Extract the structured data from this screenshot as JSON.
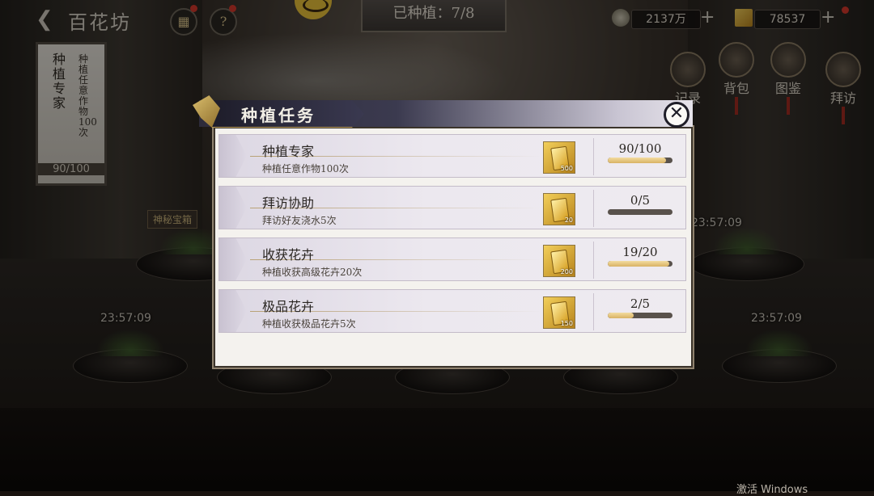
{
  "hud": {
    "title": "百花坊",
    "planted": "已种植：7/8",
    "coins": "2137万",
    "gold": "78537",
    "side_buttons": [
      "记录",
      "背包",
      "图鉴",
      "拜访"
    ]
  },
  "scroll_banner": {
    "title": "种植专家",
    "desc": "种植任意作物100次",
    "progress": "90/100"
  },
  "mystery_box": "神秘宝箱",
  "pot_timers": [
    "23:57:09",
    "23:57:09",
    "23:57:09"
  ],
  "modal": {
    "title": "种植任务",
    "tasks": [
      {
        "name": "种植专家",
        "desc": "种植任意作物100次",
        "reward_qty": "500",
        "progress": "90/100",
        "fraction": 0.9
      },
      {
        "name": "拜访协助",
        "desc": "拜访好友浇水5次",
        "reward_qty": "20",
        "progress": "0/5",
        "fraction": 0.0
      },
      {
        "name": "收获花卉",
        "desc": "种植收获高级花卉20次",
        "reward_qty": "200",
        "progress": "19/20",
        "fraction": 0.95
      },
      {
        "name": "极品花卉",
        "desc": "种植收获极品花卉5次",
        "reward_qty": "150",
        "progress": "2/5",
        "fraction": 0.4
      }
    ]
  },
  "watermark": "激活 Windows",
  "icons": {
    "back": "back-arrow-icon",
    "grid": "grid-menu-icon",
    "help": "help-icon",
    "coin": "coin-icon",
    "gold": "gold-bar-icon",
    "close": "close-icon"
  },
  "colors": {
    "progress_fill": "#d8b264",
    "progress_track": "#59524c",
    "header_dark": "#2d2b3a",
    "notice_dot": "#d4382b"
  }
}
